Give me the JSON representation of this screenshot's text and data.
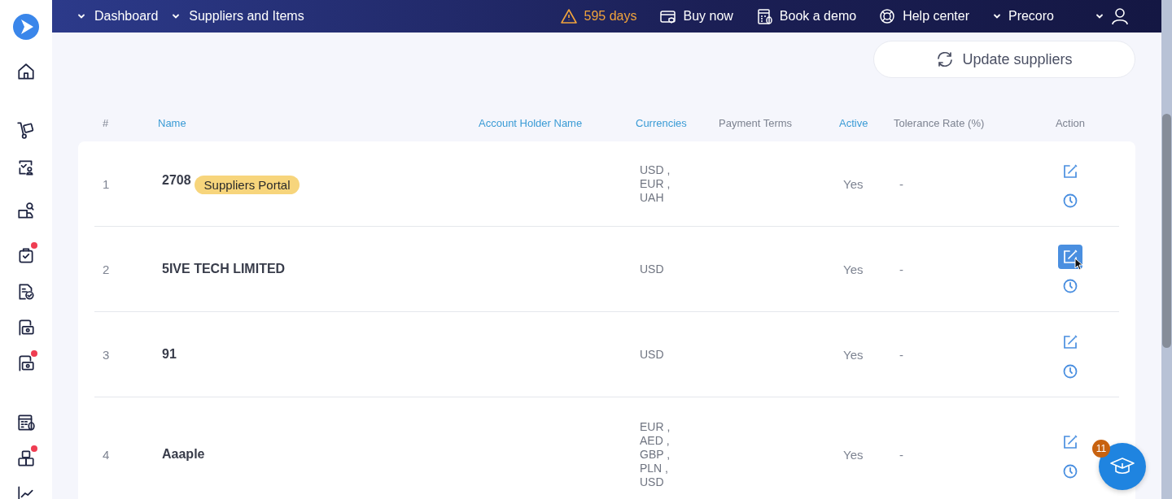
{
  "sidebar": {
    "items": [
      {
        "badge": false
      },
      {
        "badge": false
      },
      {
        "badge": false
      },
      {
        "badge": false
      },
      {
        "badge": true
      },
      {
        "badge": false
      },
      {
        "badge": false
      },
      {
        "badge": true
      },
      {
        "badge": false
      },
      {
        "badge": true
      },
      {
        "badge": false
      }
    ]
  },
  "topbar": {
    "breadcrumbs": [
      "Dashboard",
      "Suppliers and Items"
    ],
    "trial": "595 days",
    "links": [
      "Buy now",
      "Book a demo",
      "Help center"
    ],
    "company": "Precoro"
  },
  "toolbar": {
    "update_button": "Update suppliers"
  },
  "table": {
    "columns": [
      {
        "label": "#",
        "sortable": false
      },
      {
        "label": "Name",
        "sortable": true
      },
      {
        "label": "Account Holder Name",
        "sortable": true
      },
      {
        "label": "Currencies",
        "sortable": true
      },
      {
        "label": "Payment Terms",
        "sortable": false
      },
      {
        "label": "Active",
        "sortable": true
      },
      {
        "label": "Tolerance Rate (%)",
        "sortable": false
      },
      {
        "label": "Action",
        "sortable": false
      }
    ],
    "rows": [
      {
        "number": "1",
        "name": "2708",
        "tag": "Suppliers Portal",
        "currencies": [
          "USD ,",
          "EUR ,",
          "UAH"
        ],
        "active": "Yes",
        "tolerance": "-",
        "edit_highlighted": false
      },
      {
        "number": "2",
        "name": "5IVE TECH LIMITED",
        "currencies": [
          "USD"
        ],
        "active": "Yes",
        "tolerance": "-",
        "edit_highlighted": true
      },
      {
        "number": "3",
        "name": "91",
        "currencies": [
          "USD"
        ],
        "active": "Yes",
        "tolerance": "-",
        "edit_highlighted": false
      },
      {
        "number": "4",
        "name": "Aaaple",
        "currencies": [
          "EUR ,",
          "AED ,",
          "GBP ,",
          "PLN ,",
          "USD"
        ],
        "active": "Yes",
        "tolerance": "-",
        "edit_highlighted": false
      }
    ]
  },
  "help": {
    "count": "11"
  }
}
